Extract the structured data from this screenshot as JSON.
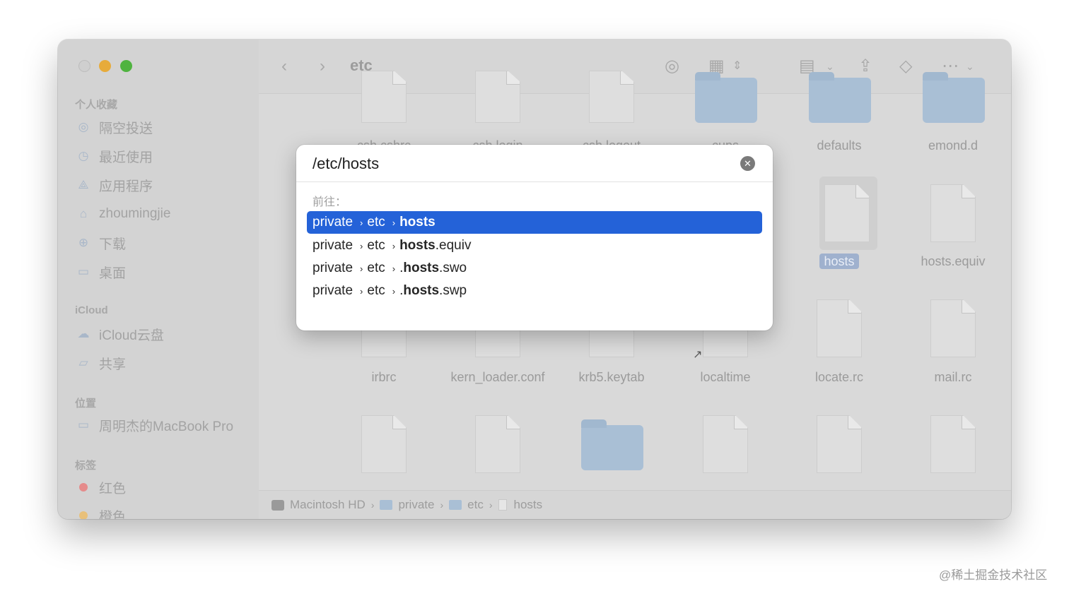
{
  "window": {
    "title": "etc"
  },
  "sidebar": {
    "favorites_header": "个人收藏",
    "favorites": [
      {
        "label": "隔空投送",
        "icon": "airdrop-icon"
      },
      {
        "label": "最近使用",
        "icon": "clock-icon"
      },
      {
        "label": "应用程序",
        "icon": "applications-icon"
      },
      {
        "label": "zhoumingjie",
        "icon": "home-icon"
      },
      {
        "label": "下载",
        "icon": "download-icon"
      },
      {
        "label": "桌面",
        "icon": "desktop-icon"
      }
    ],
    "icloud_header": "iCloud",
    "icloud": [
      {
        "label": "iCloud云盘",
        "icon": "cloud-icon"
      },
      {
        "label": "共享",
        "icon": "shared-folder-icon"
      }
    ],
    "locations_header": "位置",
    "locations": [
      {
        "label": "周明杰的MacBook Pro",
        "icon": "laptop-icon"
      }
    ],
    "tags_header": "标签",
    "tags": [
      {
        "label": "红色",
        "color": "#e58b8b"
      },
      {
        "label": "橙色",
        "color": "#e8c07a"
      }
    ]
  },
  "files": {
    "row1": [
      "csh.cshrc",
      "csh.login",
      "csh.logout",
      "cups",
      "defaults",
      "emond.d"
    ],
    "row2_right": [
      "hosts",
      "hosts.equiv"
    ],
    "row3": [
      "irbrc",
      "kern_loader.conf",
      "krb5.keytab",
      "localtime",
      "locate.rc",
      "mail.rc"
    ]
  },
  "statusbar": {
    "path": [
      "Macintosh HD",
      "private",
      "etc",
      "hosts"
    ]
  },
  "goto_dialog": {
    "input_value": "/etc/hosts",
    "goto_label": "前往：",
    "suggestions": [
      {
        "p1": "private",
        "p2": "etc",
        "prefix": "",
        "bold": "hosts",
        "suffix": ""
      },
      {
        "p1": "private",
        "p2": "etc",
        "prefix": "",
        "bold": "hosts",
        "suffix": ".equiv"
      },
      {
        "p1": "private",
        "p2": "etc",
        "prefix": ".",
        "bold": "hosts",
        "suffix": ".swo"
      },
      {
        "p1": "private",
        "p2": "etc",
        "prefix": ".",
        "bold": "hosts",
        "suffix": ".swp"
      }
    ],
    "selected_index": 0,
    "accent_color": "#2462d8"
  },
  "watermark": "@稀土掘金技术社区"
}
